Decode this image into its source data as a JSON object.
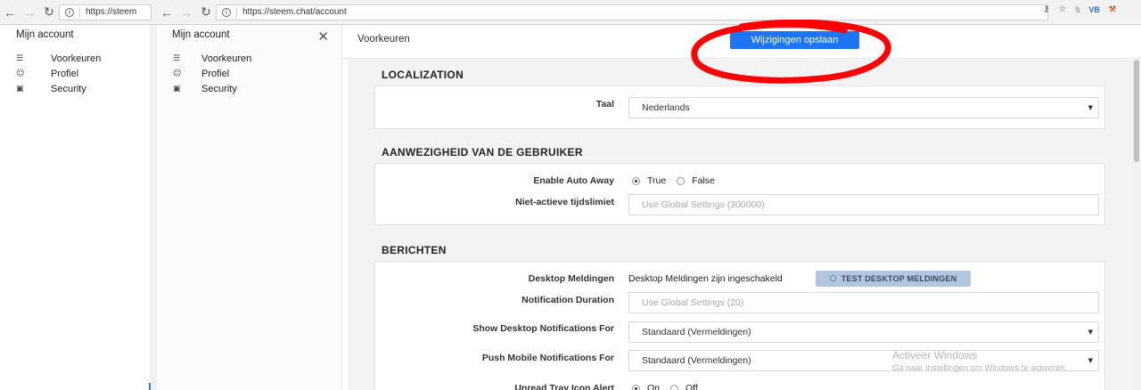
{
  "browser": {
    "left_url": "https://steem",
    "right_url": "https://steem.chat/account",
    "extensions": [
      "\\\\",
      "VB",
      "⚒"
    ]
  },
  "sidebar": {
    "title": "Mijn account",
    "items": [
      {
        "label": "Voorkeuren",
        "icon": "sliders-icon"
      },
      {
        "label": "Profiel",
        "icon": "user-icon"
      },
      {
        "label": "Security",
        "icon": "lock-icon"
      }
    ]
  },
  "header": {
    "title": "Voorkeuren",
    "save_label": "Wijzigingen opslaan"
  },
  "sections": {
    "localization": {
      "title": "LOCALIZATION",
      "taal_label": "Taal",
      "taal_value": "Nederlands"
    },
    "presence": {
      "title": "AANWEZIGHEID VAN DE GEBRUIKER",
      "auto_away_label": "Enable Auto Away",
      "true_label": "True",
      "false_label": "False",
      "timeout_label": "Niet-actieve tijdslimiet",
      "timeout_placeholder": "Use Global Settings (300000)"
    },
    "messages": {
      "title": "BERICHTEN",
      "desktop_label": "Desktop Meldingen",
      "desktop_status": "Desktop Meldingen zijn ingeschakeld",
      "test_button": "TEST DESKTOP MELDINGEN",
      "duration_label": "Notification Duration",
      "duration_placeholder": "Use Global Settings (20)",
      "desktop_for_label": "Show Desktop Notifications For",
      "desktop_for_value": "Standaard (Vermeldingen)",
      "mobile_for_label": "Push Mobile Notifications For",
      "mobile_for_value": "Standaard (Vermeldingen)",
      "tray_label": "Unread Tray Icon Alert",
      "tray_on": "On",
      "tray_off": "Off"
    }
  },
  "watermark": {
    "line1": "Activeer Windows",
    "line2": "Ga naar Instellingen om Windows te activeren."
  },
  "colors": {
    "primary_button": "#1d74f5",
    "annotation": "#ff0000"
  }
}
